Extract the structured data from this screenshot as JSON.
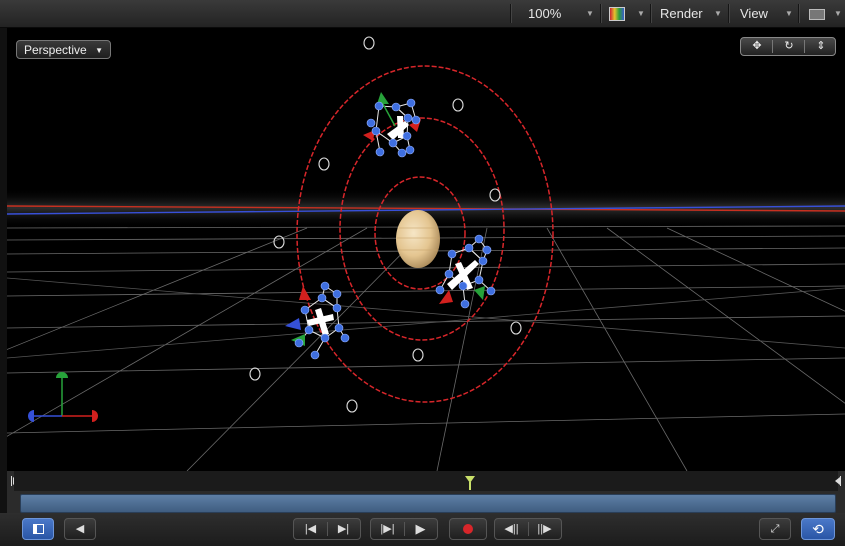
{
  "toolbar": {
    "zoom": "100%",
    "render_label": "Render",
    "view_label": "View"
  },
  "viewport": {
    "camera_menu": "Perspective"
  },
  "colors": {
    "orbit": "#d8262a",
    "joint": "#3f6fe0",
    "axis_x": "#d2201e",
    "axis_y": "#27a23a",
    "axis_z": "#3550d8",
    "planet": "#e9cfa1",
    "timeline_track": "#4c6e96",
    "active_button": "#3465b9"
  },
  "icons": {
    "color_channels": "color-channels-icon",
    "layout": "layout-icon",
    "pan": "pan-icon",
    "orbit": "orbit-icon",
    "dolly": "dolly-icon",
    "show_panel": "show-panel-icon",
    "audio": "audio-icon",
    "go_to_start": "go-to-start-icon",
    "go_to_end": "go-to-end-icon",
    "play_range": "play-range-icon",
    "play": "play-icon",
    "record": "record-icon",
    "prev_frame": "previous-frame-icon",
    "next_frame": "next-frame-icon",
    "fullscreen": "fullscreen-icon",
    "loop": "loop-icon"
  }
}
